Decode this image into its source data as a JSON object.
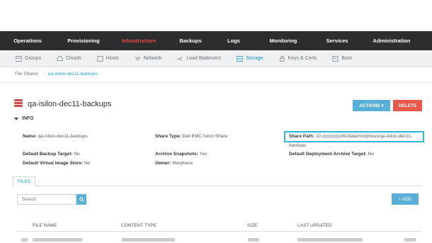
{
  "nav": {
    "items": [
      {
        "label": "Operations",
        "active": false
      },
      {
        "label": "Provisioning",
        "active": false
      },
      {
        "label": "Infrastructure",
        "active": true
      },
      {
        "label": "Backups",
        "active": false
      },
      {
        "label": "Logs",
        "active": false
      },
      {
        "label": "Monitoring",
        "active": false
      },
      {
        "label": "Services",
        "active": false
      },
      {
        "label": "Administration",
        "active": false
      }
    ]
  },
  "subnav": {
    "items": [
      {
        "label": "Groups",
        "icon": "groups-icon"
      },
      {
        "label": "Clouds",
        "icon": "cloud-icon"
      },
      {
        "label": "Hosts",
        "icon": "hosts-icon"
      },
      {
        "label": "Network",
        "icon": "network-icon"
      },
      {
        "label": "Load Balancers",
        "icon": "load-balancer-icon"
      },
      {
        "label": "Storage",
        "icon": "storage-icon",
        "active": true
      },
      {
        "label": "Keys & Certs",
        "icon": "lock-icon"
      },
      {
        "label": "Boot",
        "icon": "boot-icon"
      }
    ]
  },
  "breadcrumb": {
    "parent": "File Shares",
    "current": "qa-isilon-dec11-backups"
  },
  "page": {
    "title": "qa-isilon-dec11-backups",
    "actions_label": "ACTIONS",
    "delete_label": "DELETE",
    "info_label": "INFO"
  },
  "info": {
    "name_label": "Name:",
    "name_value": "qa-isilon-dec11-backups",
    "share_type_label": "Share Type:",
    "share_type_value": "Dell EMC Isilon Share",
    "share_path_label": "Share Path:",
    "share_path_prefix": "10.",
    "share_path_value": "/ifs/data/morpheus/qa-isilon-dec11-",
    "share_path_cont": "backups",
    "backup_target_label": "Default Backup Target:",
    "backup_target_value": "No",
    "archive_snapshots_label": "Archive Snapshots:",
    "archive_snapshots_value": "Yes",
    "deploy_archive_label": "Default Deployment Archive Target:",
    "deploy_archive_value": "No",
    "vi_store_label": "Default Virtual Image Store:",
    "vi_store_value": "No",
    "owner_label": "Owner:",
    "owner_value": "Morpheus"
  },
  "files": {
    "tab_label": "FILES",
    "search_placeholder": "Search",
    "add_label": "+ ADD",
    "columns": [
      "FILE NAME",
      "CONTENT TYPE",
      "SIZE",
      "LAST UPDATED"
    ]
  },
  "colors": {
    "accent": "#1a9ac9",
    "active_nav": "#e8493f",
    "button": "#5aafd6",
    "danger": "#e8574a",
    "highlight": "#2fb8d6"
  }
}
